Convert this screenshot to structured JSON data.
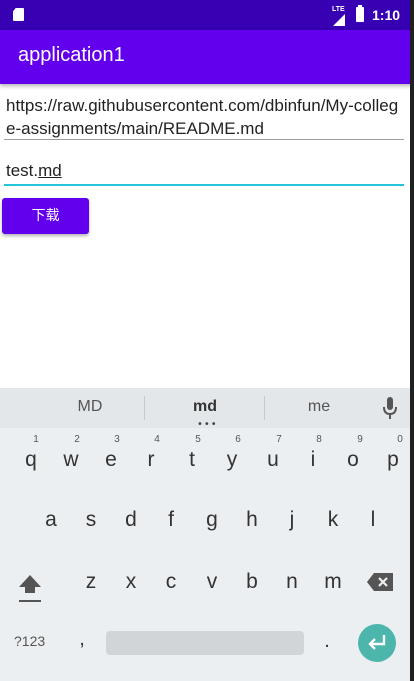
{
  "status_bar": {
    "network": "LTE",
    "time": "1:10"
  },
  "app_bar": {
    "title": "application1"
  },
  "form": {
    "url_value": "https://raw.githubusercontent.com/dbinfun/My-college-assignments/main/README.md",
    "filename_prefix": "test.",
    "filename_suffix": "md",
    "download_label": "下载"
  },
  "keyboard": {
    "suggestions": [
      "MD",
      "md",
      "me"
    ],
    "row1": [
      "q",
      "w",
      "e",
      "r",
      "t",
      "y",
      "u",
      "i",
      "o",
      "p"
    ],
    "row1_hints": [
      "1",
      "2",
      "3",
      "4",
      "5",
      "6",
      "7",
      "8",
      "9",
      "0"
    ],
    "row2": [
      "a",
      "s",
      "d",
      "f",
      "g",
      "h",
      "j",
      "k",
      "l"
    ],
    "row3": [
      "z",
      "x",
      "c",
      "v",
      "b",
      "n",
      "m"
    ],
    "symbols_label": "?123",
    "comma": ",",
    "period": ".",
    "accent_color": "#4db6ac"
  },
  "colors": {
    "primary": "#6200ee",
    "primary_dark": "#3700b3",
    "focus_underline": "#26c6da"
  },
  "icons": {
    "sd_card": "sd-card-icon",
    "signal": "signal-icon",
    "battery": "battery-icon",
    "mic": "mic-icon",
    "shift": "shift-icon",
    "backspace": "backspace-icon",
    "enter": "enter-icon"
  }
}
